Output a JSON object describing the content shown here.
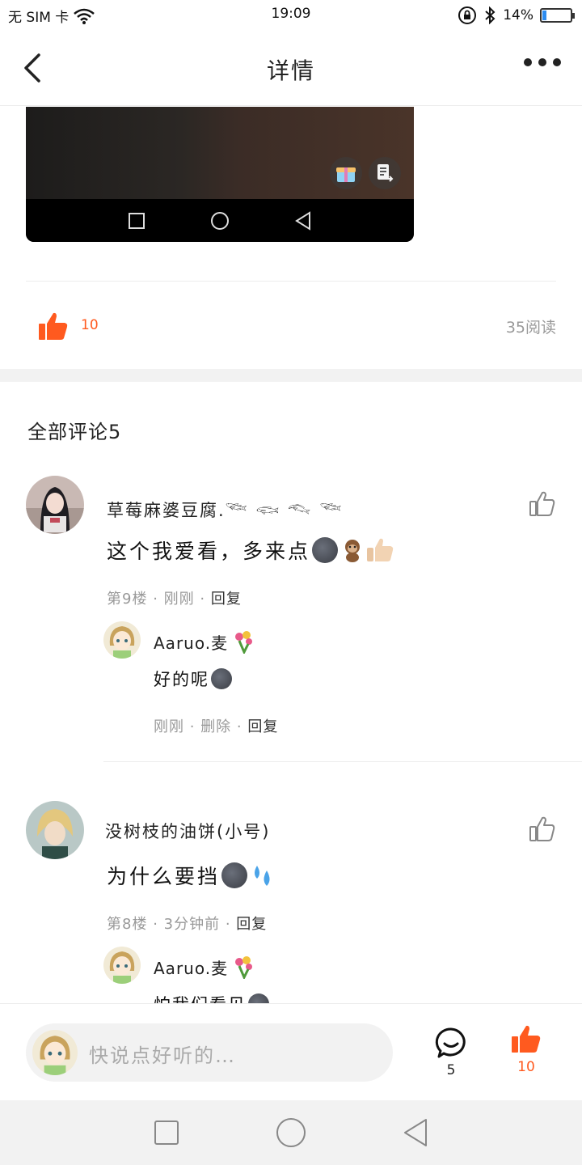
{
  "status_bar": {
    "carrier": "无 SIM 卡",
    "time": "19:09",
    "battery": "14%",
    "battery_level": 0.14
  },
  "nav": {
    "title": "详情"
  },
  "post": {
    "like_count": "10",
    "read_count": "35阅读"
  },
  "comments": {
    "title": "全部评论5",
    "items": [
      {
        "username": "草莓麻婆豆腐.𓆝 𓆟 𓆞 𓆝",
        "text": "这个我爱看，多来点",
        "floor": "第9楼",
        "time": "刚刚",
        "reply_label": "回复",
        "replies": [
          {
            "username": "Aaruo.麦",
            "text": "好的呢",
            "time": "刚刚",
            "delete_label": "删除",
            "reply_label": "回复"
          }
        ]
      },
      {
        "username": "没树枝的油饼(小号)",
        "text": "为什么要挡",
        "floor": "第8楼",
        "time": "3分钟前",
        "reply_label": "回复",
        "replies": [
          {
            "username": "Aaruo.麦",
            "text": "怕我们看见"
          }
        ]
      }
    ]
  },
  "bottom_bar": {
    "placeholder": "快说点好听的…",
    "comment_count": "5",
    "like_count": "10"
  },
  "colors": {
    "accent": "#ff5a1f",
    "muted": "#999999"
  }
}
